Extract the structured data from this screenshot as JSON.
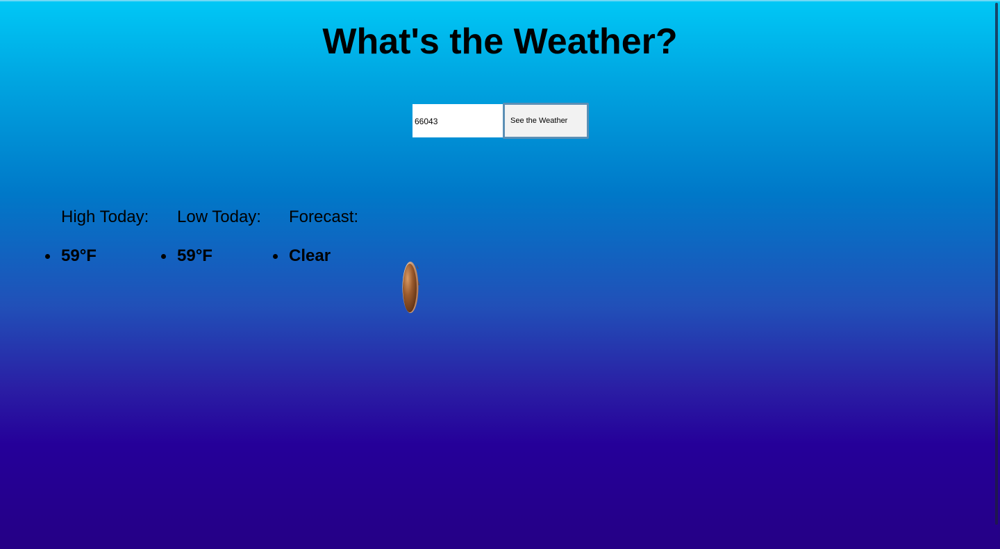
{
  "app": {
    "title": "What's the Weather?"
  },
  "search": {
    "zip_value": "66043",
    "button_label": "See the Weather"
  },
  "results": {
    "high": {
      "label": "High Today:",
      "value": "59°F"
    },
    "low": {
      "label": "Low Today:",
      "value": "59°F"
    },
    "forecast": {
      "label": "Forecast:",
      "value": "Clear"
    }
  },
  "icon": {
    "name": "weather-condition-icon"
  },
  "colors": {
    "gradient_top": "#00c8f6",
    "gradient_mid": "#0078c8",
    "gradient_bottom": "#250085",
    "button_border": "#5b8fb5"
  }
}
